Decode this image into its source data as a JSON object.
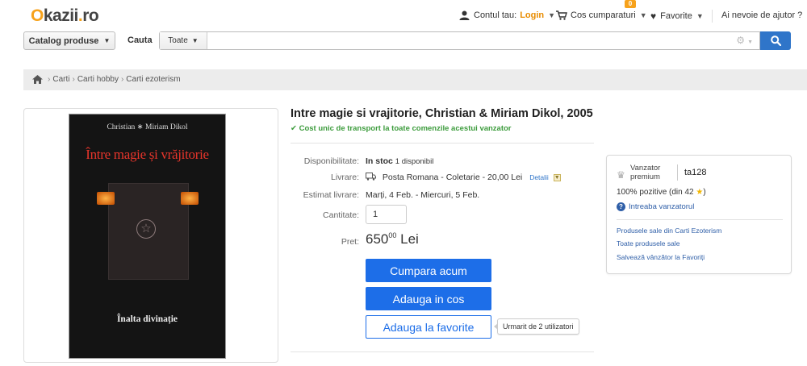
{
  "header": {
    "logo": {
      "o": "O",
      "rest": "kazii",
      "dot": ".",
      "ro": "ro"
    },
    "account": {
      "label": "Contul tau:",
      "login": "Login"
    },
    "cart": {
      "label": "Cos cumparaturi",
      "count": "0"
    },
    "favorites": "Favorite",
    "help": "Ai nevoie de ajutor ?"
  },
  "search": {
    "catalog_label": "Catalog produse",
    "search_label": "Cauta",
    "scope": "Toate",
    "query": "",
    "placeholder": ""
  },
  "breadcrumb": [
    "Carti",
    "Carti hobby",
    "Carti ezoterism"
  ],
  "book_cover": {
    "authors": "Christian ∗ Miriam Dikol",
    "title": "Între magie și vrăjitorie",
    "subtitle": "Înalta divinație"
  },
  "product": {
    "title": "Intre magie si vrajitorie, Christian & Miriam Dikol, 2005",
    "shipping_note": "Cost unic de transport la toate comenzile acestui vanzator",
    "availability_label": "Disponibilitate:",
    "availability_value": "In stoc",
    "availability_count": "1 disponibil",
    "delivery_label": "Livrare:",
    "delivery_value": "Posta Romana - Coletarie - 20,00 Lei",
    "delivery_details": "Detalii",
    "estimate_label": "Estimat livrare:",
    "estimate_value": "Marți, 4 Feb. - Miercuri, 5 Feb.",
    "quantity_label": "Cantitate:",
    "quantity_value": "1",
    "price_label": "Pret:",
    "price_int": "650",
    "price_dec": "00",
    "currency": "Lei",
    "buy_now": "Cumpara acum",
    "add_to_cart": "Adauga in cos",
    "add_to_favorites": "Adauga la favorite",
    "watchers": "Urmarit de 2 utilizatori"
  },
  "seller": {
    "tier": "Vanzator premium",
    "name": "ta128",
    "rating": "100% pozitive (din 42",
    "rating_end": ")",
    "ask": "Intreaba vanzatorul",
    "links": [
      "Produsele sale din Carti Ezoterism",
      "Toate produsele sale",
      "Salvează vânzător la Favoriți"
    ]
  },
  "colors": {
    "accent": "#1d6ee8",
    "brand": "#f7a21b",
    "success": "#3b9b3b"
  }
}
